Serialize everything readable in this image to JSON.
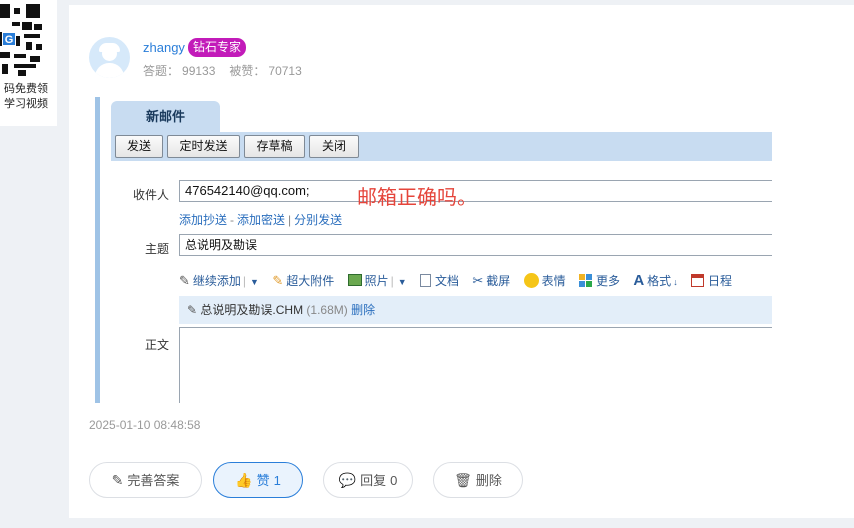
{
  "promo": {
    "line1": "码免费领",
    "line2": "学习视频",
    "qr_logo": "G"
  },
  "author": {
    "name": "zhangy",
    "badge": "钻石专家",
    "answers_label": "答题：",
    "answers": "99133",
    "likes_label": "被赞：",
    "likes": "70713"
  },
  "screenshot": {
    "tab": "新邮件",
    "buttons": [
      "发送",
      "定时发送",
      "存草稿",
      "关闭"
    ],
    "to_label": "收件人",
    "to_value": "476542140@qq.com;",
    "annotation": "邮箱正确吗。",
    "links": [
      "添加抄送",
      "添加密送",
      "分别发送"
    ],
    "subject_label": "主题",
    "subject_value": "总说明及勘误",
    "tools": [
      "继续添加",
      "超大附件",
      "照片",
      "文档",
      "截屏",
      "表情",
      "更多",
      "格式",
      "日程"
    ],
    "attachment": {
      "name": "总说明及勘误.CHM",
      "size": "(1.68M)",
      "delete": "删除"
    },
    "body_label": "正文"
  },
  "timestamp": "2025-01-10 08:48:58",
  "actions": {
    "improve": "完善答案",
    "like": "赞",
    "like_count": "1",
    "reply": "回复",
    "reply_count": "0",
    "delete": "删除"
  },
  "icons": [
    "paperclip-icon",
    "image-icon",
    "document-icon",
    "scissors-icon",
    "smiley-icon",
    "grid-icon",
    "format-icon",
    "calendar-icon",
    "edit-icon",
    "thumbs-up-icon",
    "comment-icon",
    "trash-icon"
  ],
  "colors": {
    "accent": "#2a7ed9",
    "badge": "#c21bb9",
    "annotation": "#e5453b",
    "toolbar": "#c8dcf1"
  }
}
